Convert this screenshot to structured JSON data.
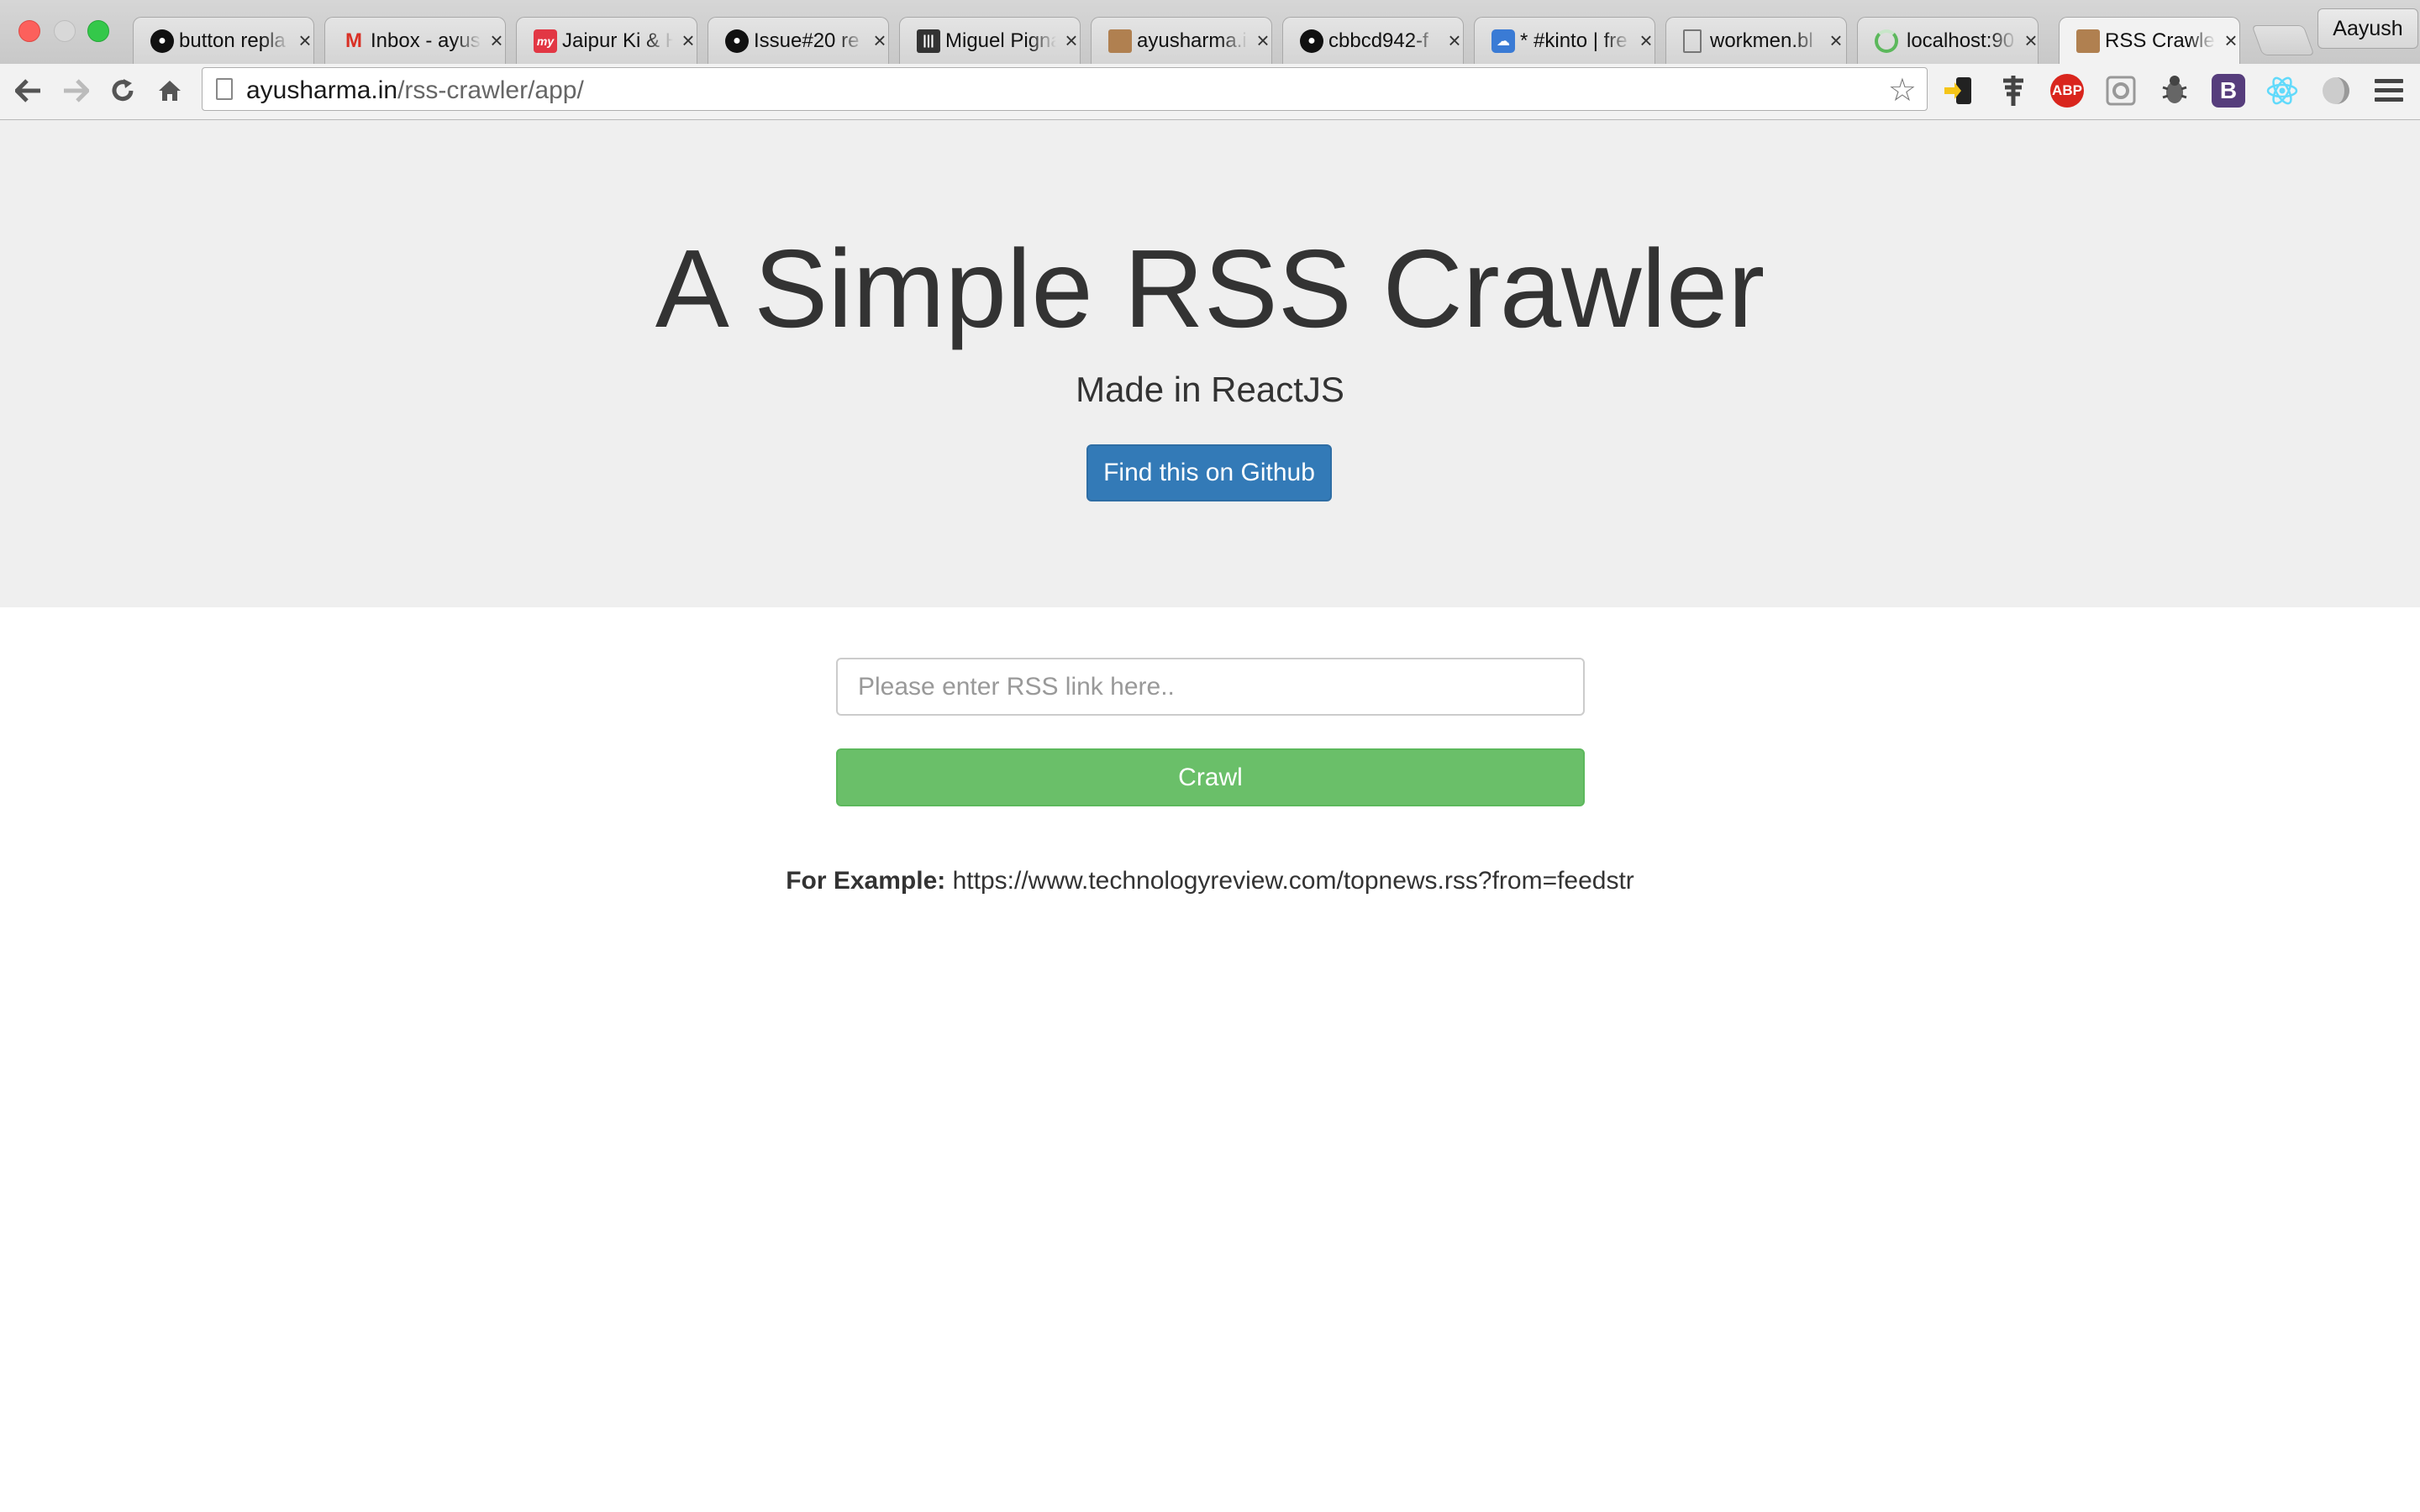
{
  "browser": {
    "tabs": [
      {
        "title": "button repla",
        "icon": "github-icon",
        "active": false
      },
      {
        "title": "Inbox - ayus",
        "icon": "gmail-icon",
        "active": false
      },
      {
        "title": "Jaipur Ki & H",
        "icon": "paytm-icon",
        "active": false
      },
      {
        "title": "Issue#20 re",
        "icon": "github-icon",
        "active": false
      },
      {
        "title": "Miguel Pigna",
        "icon": "medium-icon",
        "active": false
      },
      {
        "title": "ayusharma.i",
        "icon": "avatar-icon",
        "active": false
      },
      {
        "title": "cbbcd942-f",
        "icon": "github-icon",
        "active": false
      },
      {
        "title": "* #kinto | fre",
        "icon": "irc-cloud-icon",
        "active": false
      },
      {
        "title": "workmen.bl",
        "icon": "document-icon",
        "active": false
      },
      {
        "title": "localhost:90",
        "icon": "loading-icon",
        "active": false
      },
      {
        "title": "RSS Crawler",
        "icon": "avatar-icon",
        "active": true
      }
    ],
    "profile_name": "Aayush",
    "url": {
      "domain": "ayusharma.in",
      "path": "/rss-crawler/app/"
    },
    "extensions": {
      "abp_label": "ABP",
      "bootstrap_label": "B"
    }
  },
  "hero": {
    "title": "A Simple RSS Crawler",
    "subtitle": "Made in ReactJS",
    "github_button": "Find this on Github"
  },
  "form": {
    "input_placeholder": "Please enter RSS link here..",
    "input_value": "",
    "crawl_button": "Crawl"
  },
  "example": {
    "label": "For Example:",
    "url": "https://www.technologyreview.com/topnews.rss?from=feedstr"
  },
  "colors": {
    "primary": "#337ab7",
    "success": "#6abf69",
    "jumbotron_bg": "#efefef",
    "text": "#333333"
  }
}
